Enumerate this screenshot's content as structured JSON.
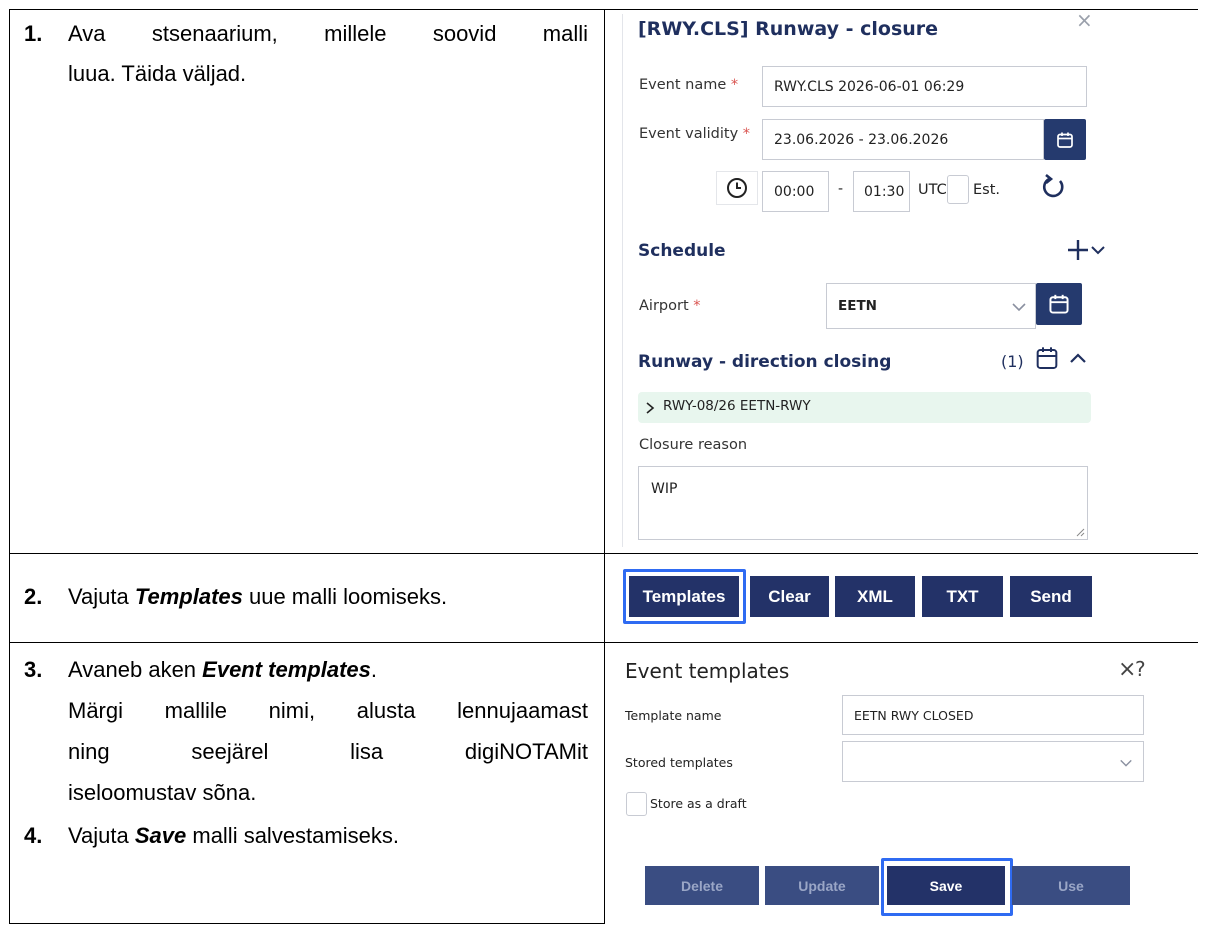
{
  "steps": {
    "s1": {
      "num": "1.",
      "line1": "Ava stsenaarium, millele soovid malli",
      "line2": "luua. Täida väljad."
    },
    "s2": {
      "num": "2.",
      "pre": "Vajuta ",
      "bold": "Templates",
      "post": " uue malli loomiseks."
    },
    "s3": {
      "num": "3.",
      "pre": "Avaneb aken  ",
      "bold": "Event templates",
      "post": ".",
      "line2": "Märgi mallile nimi, alusta lennujaamast",
      "line3_words": [
        "ning",
        "seejärel",
        "lisa",
        "digiNOTAMit"
      ],
      "line4": "iseloomustav sõna."
    },
    "s4": {
      "num": "4.",
      "pre": "Vajuta ",
      "bold": "Save",
      "post": " malli salvestamiseks."
    }
  },
  "event_form": {
    "title": "[RWY.CLS] Runway - closure",
    "close_glyph": "×",
    "event_name_label": "Event name",
    "event_name_value": "RWY.CLS 2026-06-01 06:29",
    "validity_label": "Event validity",
    "validity_value": "23.06.2026 - 23.06.2026",
    "required_mark": "*",
    "time_from": "00:00",
    "time_sep": "-",
    "time_to": "01:30",
    "utc_label": "UTC",
    "est_label": "Est.",
    "schedule_label": "Schedule",
    "airport_label": "Airport",
    "airport_value": "EETN",
    "runway_section_label": "Runway - direction closing",
    "runway_count": "(1)",
    "runway_item": "RWY-08/26 EETN-RWY",
    "closure_reason_label": "Closure reason",
    "closure_reason_value": "WIP"
  },
  "action_bar": {
    "templates": "Templates",
    "clear": "Clear",
    "xml": "XML",
    "txt": "TXT",
    "send": "Send"
  },
  "templates_dialog": {
    "title": "Event templates",
    "close_glyph": "×",
    "help_glyph": "?",
    "template_name_label": "Template name",
    "template_name_value": "EETN RWY CLOSED",
    "stored_label": "Stored templates",
    "stored_value": "",
    "draft_label": "Store as a draft",
    "buttons": {
      "delete": "Delete",
      "update": "Update",
      "save": "Save",
      "use": "Use"
    }
  },
  "colors": {
    "navy": "#253a6e",
    "highlight": "#2f6bf2",
    "required": "#d9534f",
    "runway_row": "#e8f6ee"
  }
}
